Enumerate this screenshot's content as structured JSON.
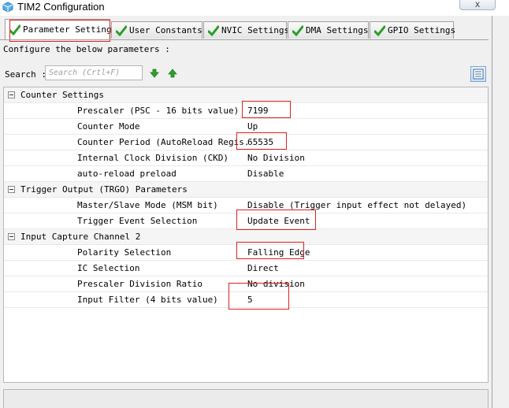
{
  "window": {
    "title": "TIM2 Configuration",
    "close_label": "x"
  },
  "tabs": [
    {
      "label": "Parameter Settings",
      "active": true
    },
    {
      "label": "User Constants",
      "active": false
    },
    {
      "label": "NVIC Settings",
      "active": false
    },
    {
      "label": "DMA Settings",
      "active": false
    },
    {
      "label": "GPIO Settings",
      "active": false
    }
  ],
  "configure_text": "Configure the below parameters :",
  "search": {
    "label": "Search :",
    "placeholder": "Search (Crtl+F)"
  },
  "icons": {
    "app": "cube-icon",
    "tab_check": "check-icon",
    "down": "arrow-down-icon",
    "up": "arrow-up-icon",
    "list": "list-view-icon"
  },
  "groups": [
    {
      "name": "Counter Settings",
      "params": [
        {
          "name": "Prescaler (PSC - 16 bits value)",
          "value": "7199"
        },
        {
          "name": "Counter Mode",
          "value": "Up"
        },
        {
          "name": "Counter Period (AutoReload Regis.",
          "value": "65535"
        },
        {
          "name": "Internal Clock Division (CKD)",
          "value": "No Division"
        },
        {
          "name": "auto-reload preload",
          "value": "Disable"
        }
      ]
    },
    {
      "name": "Trigger Output (TRGO) Parameters",
      "params": [
        {
          "name": "Master/Slave Mode (MSM bit)",
          "value": "Disable (Trigger input effect not delayed)"
        },
        {
          "name": "Trigger Event Selection",
          "value": "Update Event"
        }
      ]
    },
    {
      "name": "Input Capture Channel 2",
      "params": [
        {
          "name": "Polarity Selection",
          "value": "Falling Edge"
        },
        {
          "name": "IC Selection",
          "value": "Direct"
        },
        {
          "name": "Prescaler Division Ratio",
          "value": "No division"
        },
        {
          "name": "Input Filter (4 bits value)",
          "value": "5"
        }
      ]
    }
  ],
  "colors": {
    "highlight": "#e02020",
    "check": "#2a9d2a",
    "arrow": "#2ea02e"
  }
}
